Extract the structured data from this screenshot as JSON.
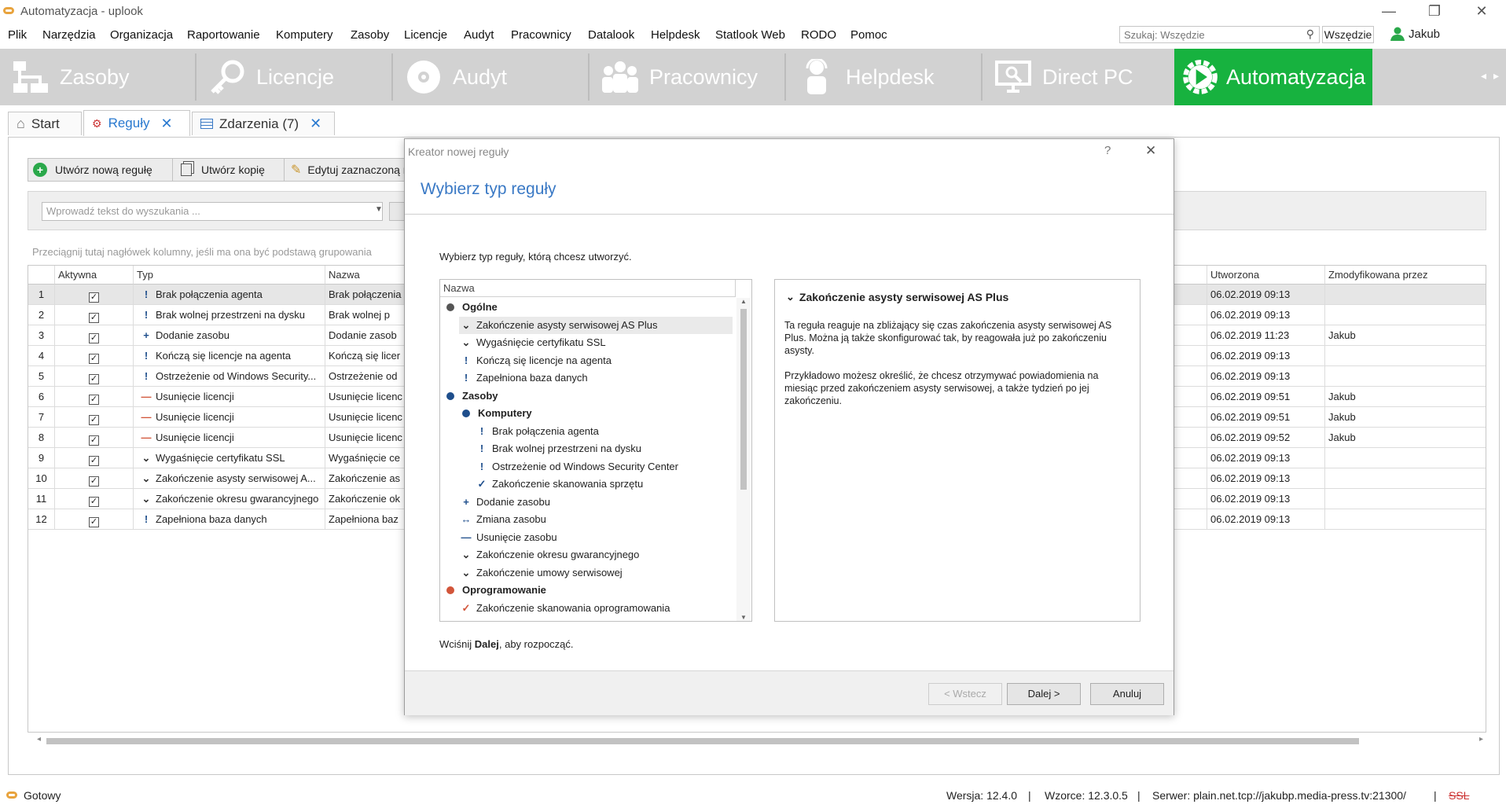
{
  "window": {
    "title": "Automatyzacja - uplook",
    "min": "—",
    "restore": "❐",
    "close": "✕"
  },
  "menu": [
    "Plik",
    "Narzędzia",
    "Organizacja",
    "Raportowanie",
    "Komputery",
    "Zasoby",
    "Licencje",
    "Audyt",
    "Pracownicy",
    "Datalook",
    "Helpdesk",
    "Statlook Web",
    "RODO",
    "Pomoc"
  ],
  "search": {
    "placeholder": "Szukaj: Wszędzie",
    "scope": "Wszędzie",
    "user": "Jakub"
  },
  "modules": [
    {
      "label": "Zasoby",
      "icon": "network-icon"
    },
    {
      "label": "Licencje",
      "icon": "key-icon"
    },
    {
      "label": "Audyt",
      "icon": "disc-icon"
    },
    {
      "label": "Pracownicy",
      "icon": "people-icon"
    },
    {
      "label": "Helpdesk",
      "icon": "helpdesk-icon"
    },
    {
      "label": "Direct PC",
      "icon": "monitor-icon"
    },
    {
      "label": "Automatyzacja",
      "icon": "play-gear-icon",
      "active": true
    }
  ],
  "tabs": {
    "start": "Start",
    "rules": "Reguły",
    "events": "Zdarzenia (7)"
  },
  "toolbar": {
    "new_rule": "Utwórz nową regułę",
    "copy": "Utwórz kopię",
    "edit": "Edytuj zaznaczoną r"
  },
  "filter": {
    "placeholder": "Wprowadź tekst do wyszukania ...",
    "group_hint": "Przeciągnij tutaj nagłówek kolumny, jeśli ma ona być podstawą grupowania"
  },
  "grid": {
    "headers": {
      "active": "Aktywna",
      "type": "Typ",
      "name": "Nazwa",
      "created": "Utworzona",
      "modified_by": "Zmodyfikowana przez"
    },
    "rows": [
      {
        "n": "1",
        "sym": "!",
        "type": "Brak połączenia agenta",
        "name": "Brak połączenia",
        "created": "06.02.2019 09:13",
        "by": ""
      },
      {
        "n": "2",
        "sym": "!",
        "type": "Brak wolnej przestrzeni na dysku",
        "name": "Brak wolnej p",
        "created": "06.02.2019 09:13",
        "by": ""
      },
      {
        "n": "3",
        "sym": "+",
        "type": "Dodanie zasobu",
        "name": "Dodanie zasob",
        "created": "06.02.2019 11:23",
        "by": "Jakub"
      },
      {
        "n": "4",
        "sym": "!",
        "type": "Kończą się licencje na agenta",
        "name": "Kończą się licer",
        "created": "06.02.2019 09:13",
        "by": ""
      },
      {
        "n": "5",
        "sym": "!",
        "type": "Ostrzeżenie od Windows Security...",
        "name": "Ostrzeżenie od",
        "created": "06.02.2019 09:13",
        "by": ""
      },
      {
        "n": "6",
        "sym": "—",
        "type": "Usunięcie licencji",
        "name": "Usunięcie licenc",
        "created": "06.02.2019 09:51",
        "by": "Jakub"
      },
      {
        "n": "7",
        "sym": "—",
        "type": "Usunięcie licencji",
        "name": "Usunięcie licenc",
        "created": "06.02.2019 09:51",
        "by": "Jakub"
      },
      {
        "n": "8",
        "sym": "—",
        "type": "Usunięcie licencji",
        "name": "Usunięcie licenc",
        "created": "06.02.2019 09:52",
        "by": "Jakub"
      },
      {
        "n": "9",
        "sym": "⌄",
        "type": "Wygaśnięcie certyfikatu SSL",
        "name": "Wygaśnięcie ce",
        "created": "06.02.2019 09:13",
        "by": ""
      },
      {
        "n": "10",
        "sym": "⌄",
        "type": "Zakończenie asysty serwisowej A...",
        "name": "Zakończenie as",
        "created": "06.02.2019 09:13",
        "by": ""
      },
      {
        "n": "11",
        "sym": "⌄",
        "type": "Zakończenie okresu gwarancyjnego",
        "name": "Zakończenie ok",
        "created": "06.02.2019 09:13",
        "by": ""
      },
      {
        "n": "12",
        "sym": "!",
        "type": "Zapełniona baza danych",
        "name": "Zapełniona baz",
        "created": "06.02.2019 09:13",
        "by": ""
      }
    ]
  },
  "dialog": {
    "title": "Kreator nowej reguły",
    "help": "?",
    "close": "✕",
    "heading": "Wybierz typ reguły",
    "intro": "Wybierz typ reguły, którą chcesz utworzyć.",
    "tree_header": "Nazwa",
    "tree": [
      {
        "label": "Ogólne",
        "kind": "group",
        "dot": "#555555",
        "level": 0
      },
      {
        "label": "Zakończenie asysty serwisowej AS Plus",
        "sym": "⌄",
        "level": 1,
        "selected": true
      },
      {
        "label": "Wygaśnięcie certyfikatu SSL",
        "sym": "⌄",
        "level": 1
      },
      {
        "label": "Kończą się licencje na agenta",
        "sym": "!",
        "level": 1
      },
      {
        "label": "Zapełniona baza danych",
        "sym": "!",
        "level": 1
      },
      {
        "label": "Zasoby",
        "kind": "group",
        "dot": "#1e4e8c",
        "level": 0
      },
      {
        "label": "Komputery",
        "kind": "group",
        "dot": "#1e4e8c",
        "level": 1
      },
      {
        "label": "Brak połączenia agenta",
        "sym": "!",
        "level": 2
      },
      {
        "label": "Brak wolnej przestrzeni na dysku",
        "sym": "!",
        "level": 2
      },
      {
        "label": "Ostrzeżenie od Windows Security Center",
        "sym": "!",
        "level": 2
      },
      {
        "label": "Zakończenie skanowania sprzętu",
        "sym": "✓",
        "level": 2
      },
      {
        "label": "Dodanie zasobu",
        "sym": "+",
        "level": 1
      },
      {
        "label": "Zmiana zasobu",
        "sym": "↔",
        "level": 1
      },
      {
        "label": "Usunięcie zasobu",
        "sym": "—",
        "level": 1
      },
      {
        "label": "Zakończenie okresu gwarancyjnego",
        "sym": "⌄",
        "level": 1
      },
      {
        "label": "Zakończenie umowy serwisowej",
        "sym": "⌄",
        "level": 1
      },
      {
        "label": "Oprogramowanie",
        "kind": "group",
        "dot": "#d2553a",
        "level": 0
      },
      {
        "label": "Zakończenie skanowania oprogramowania",
        "sym": "✓",
        "level": 1,
        "red": true
      }
    ],
    "desc_title": "Zakończenie asysty serwisowej AS Plus",
    "desc_p1": "Ta reguła reaguje na zbliżający się czas zakończenia asysty serwisowej AS Plus. Można ją także skonfigurować tak, by reagowała już po zakończeniu asysty.",
    "desc_p2": "Przykładowo możesz określić, że chcesz otrzymywać powiadomienia na miesiąc przed zakończeniem asysty serwisowej, a także tydzień po jej zakończeniu.",
    "hint_pre": "Wciśnij ",
    "hint_bold": "Dalej",
    "hint_post": ", aby rozpocząć.",
    "back": "< Wstecz",
    "next": "Dalej >",
    "cancel": "Anuluj"
  },
  "status": {
    "state": "Gotowy",
    "version": "Wersja: 12.4.0",
    "templates": "Wzorce: 12.3.0.5",
    "server": "Serwer: plain.net.tcp://jakubp.media-press.tv:21300/",
    "ssl": "SSL",
    "sep": "|"
  },
  "colors": {
    "accent": "#17b23f",
    "link": "#2a7ad0",
    "heading": "#3a79c5"
  }
}
